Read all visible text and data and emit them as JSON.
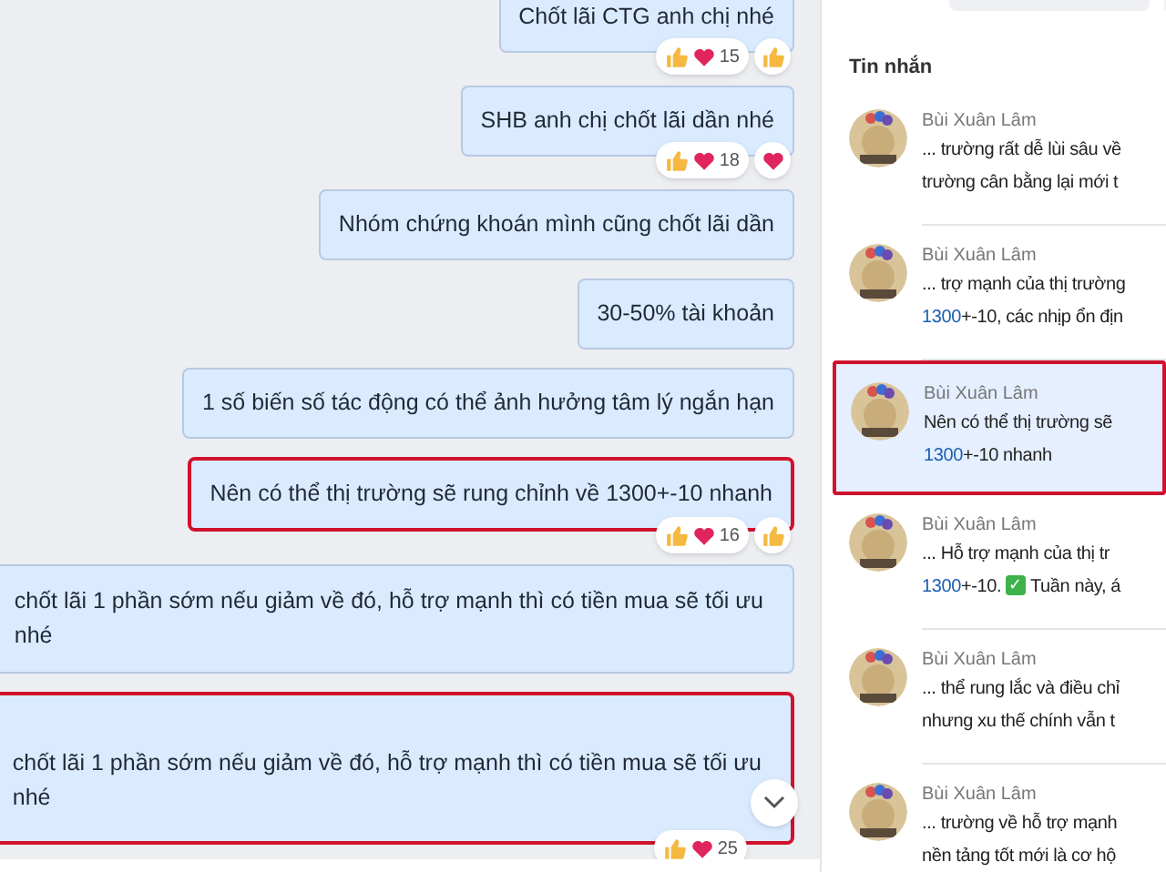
{
  "messages": [
    {
      "lines": [
        "Chốt lãi CTG anh chị nhé"
      ],
      "highlighted": false,
      "reactions": {
        "count": "15",
        "my_reaction": {
          "kind": "like"
        }
      }
    },
    {
      "lines": [
        "SHB anh chị chốt lãi dần nhé"
      ],
      "highlighted": false,
      "reactions": {
        "count": "18",
        "my_reaction": {
          "kind": "heart"
        }
      }
    },
    {
      "lines": [
        "Nhóm chứng khoán mình cũng chốt lãi dần"
      ],
      "highlighted": false
    },
    {
      "lines": [
        "30-50% tài khoản"
      ],
      "highlighted": false
    },
    {
      "lines": [
        "1 số biến số tác động có thể ảnh hưởng tâm lý ngắn hạn"
      ],
      "highlighted": false
    },
    {
      "lines": [
        "Nên có thể thị trường sẽ rung chỉnh về 1300+-10 nhanh"
      ],
      "highlighted": true,
      "reactions": {
        "count": "16",
        "my_reaction": {
          "kind": "like"
        }
      }
    },
    {
      "lines": [
        "chốt lãi 1 phần sớm nếu giảm về đó, hỗ trợ mạnh thì có tiền mua sẽ tối ưu",
        "nhé"
      ],
      "highlighted": false
    },
    {
      "lines": [
        "chốt lãi 1 phần sớm nếu giảm về đó, hỗ trợ mạnh thì có tiền mua sẽ tối ưu",
        "nhé"
      ],
      "highlighted": true,
      "reactions": {
        "count": "25"
      }
    }
  ],
  "results": {
    "heading": "Tin nhắn",
    "items": [
      {
        "sender": "Bùi Xuân Lâm",
        "selected": false,
        "lines": [
          [
            {
              "text": "... trường rất dễ lùi sâu về"
            }
          ],
          [
            {
              "text": "trường cân bằng lại mới t"
            }
          ]
        ]
      },
      {
        "sender": "Bùi Xuân Lâm",
        "selected": false,
        "lines": [
          [
            {
              "text": "... trợ mạnh của thị trường"
            }
          ],
          [
            {
              "text": "1300",
              "match": true
            },
            {
              "text": "+-10, các nhịp ổn địn"
            }
          ]
        ]
      },
      {
        "sender": "Bùi Xuân Lâm",
        "selected": true,
        "lines": [
          [
            {
              "text": "Nên có thể thị trường sẽ"
            }
          ],
          [
            {
              "text": "1300",
              "match": true
            },
            {
              "text": "+-10 nhanh"
            }
          ]
        ]
      },
      {
        "sender": "Bùi Xuân Lâm",
        "selected": false,
        "lines": [
          [
            {
              "text": "... Hỗ trợ mạnh của thị tr"
            }
          ],
          [
            {
              "text": "1300",
              "match": true
            },
            {
              "text": "+-10. "
            },
            {
              "text": "✓",
              "check": true
            },
            {
              "text": " Tuần này, á"
            }
          ]
        ]
      },
      {
        "sender": "Bùi Xuân Lâm",
        "selected": false,
        "lines": [
          [
            {
              "text": "... thể rung lắc và điều chỉ"
            }
          ],
          [
            {
              "text": "nhưng xu thế chính vẫn t"
            }
          ]
        ]
      },
      {
        "sender": "Bùi Xuân Lâm",
        "selected": false,
        "lines": [
          [
            {
              "text": "... trường về hỗ trợ mạnh"
            }
          ],
          [
            {
              "text": "nền tảng tốt mới là cơ hộ"
            }
          ]
        ]
      }
    ]
  }
}
